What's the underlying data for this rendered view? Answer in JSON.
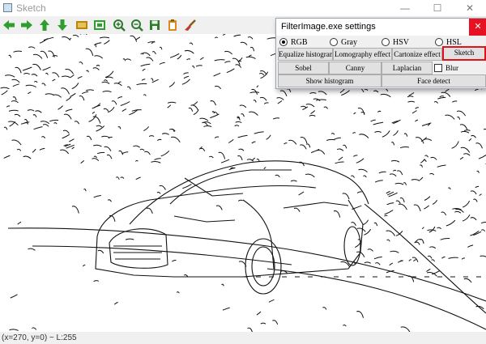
{
  "window": {
    "title": "Sketch",
    "minimize": "—",
    "maximize": "☐",
    "close": "✕"
  },
  "toolbar": {
    "buttons": [
      {
        "name": "back-arrow-icon",
        "color": "#2f9e2f"
      },
      {
        "name": "forward-arrow-icon",
        "color": "#2f9e2f"
      },
      {
        "name": "up-arrow-icon",
        "color": "#2f9e2f"
      },
      {
        "name": "down-arrow-icon",
        "color": "#2f9e2f"
      },
      {
        "name": "image-icon",
        "color": "#b8860b"
      },
      {
        "name": "fit-icon",
        "color": "#2f9e2f"
      },
      {
        "name": "zoom-in-icon",
        "color": "#2f7a2f"
      },
      {
        "name": "zoom-out-icon",
        "color": "#2f7a2f"
      },
      {
        "name": "save-icon",
        "color": "#2f7a2f"
      },
      {
        "name": "clipboard-icon",
        "color": "#d98a1c"
      },
      {
        "name": "brush-icon",
        "color": "#c0392b"
      }
    ]
  },
  "status": {
    "text": "(x=270, y=0) ~ L:255"
  },
  "dialog": {
    "title": "FilterImage.exe settings",
    "close": "✕",
    "color_modes": [
      {
        "label": "RGB",
        "selected": true
      },
      {
        "label": "Gray",
        "selected": false
      },
      {
        "label": "HSV",
        "selected": false
      },
      {
        "label": "HSL",
        "selected": false
      }
    ],
    "row1": [
      "Equalize histogram",
      "Lomography effect",
      "Cartonize effect",
      "Sketch"
    ],
    "row2": [
      "Sobel",
      "Canny",
      "Laplacian"
    ],
    "blur_label": "Blur",
    "blur_checked": false,
    "row3": [
      "Show histogram",
      "Face detect"
    ],
    "selected_button": "Sketch",
    "highlight_color": "#e0131b"
  }
}
